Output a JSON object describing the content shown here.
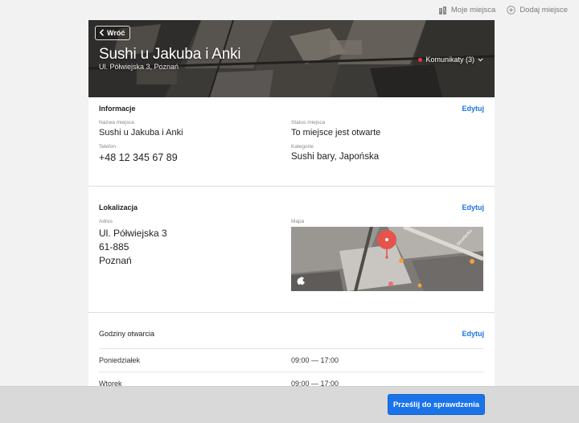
{
  "topbar": {
    "my_places": "Moje miejsca",
    "add_place": "Dodaj miejsce"
  },
  "hero": {
    "back_label": "Wróć",
    "title": "Sushi u Jakuba i Anki",
    "subtitle": "Ul. Półwiejska 3, Poznań",
    "alerts_label": "Komunikaty (3)"
  },
  "info": {
    "title": "Informacje",
    "edit": "Edytuj",
    "name_label": "Nazwa miejsca",
    "name_value": "Sushi u Jakuba i Anki",
    "status_label": "Status miejsca",
    "status_value": "To miejsce jest otwarte",
    "phone_label": "Telefon",
    "phone_value": "+48 12 345 67 89",
    "category_label": "Kategorie",
    "category_value": "Sushi bary, Japońska"
  },
  "location": {
    "title": "Lokalizacja",
    "edit": "Edytuj",
    "address_label": "Adres",
    "address_lines": [
      "Ul. Półwiejska 3",
      "61-885",
      "Poznań"
    ],
    "map_label": "Mapa",
    "map_street": "Strzelecka"
  },
  "hours": {
    "title": "Godziny otwarcia",
    "edit": "Edytuj",
    "rows": [
      {
        "day": "Poniedziałek",
        "time": "09:00 — 17:00"
      },
      {
        "day": "Wtorek",
        "time": "09:00 — 17:00"
      }
    ]
  },
  "footer": {
    "submit": "Prześlij do sprawdzenia"
  },
  "colors": {
    "accent": "#1a73e8",
    "alert_dot": "#e53935",
    "map_pin": "#e5534b"
  }
}
